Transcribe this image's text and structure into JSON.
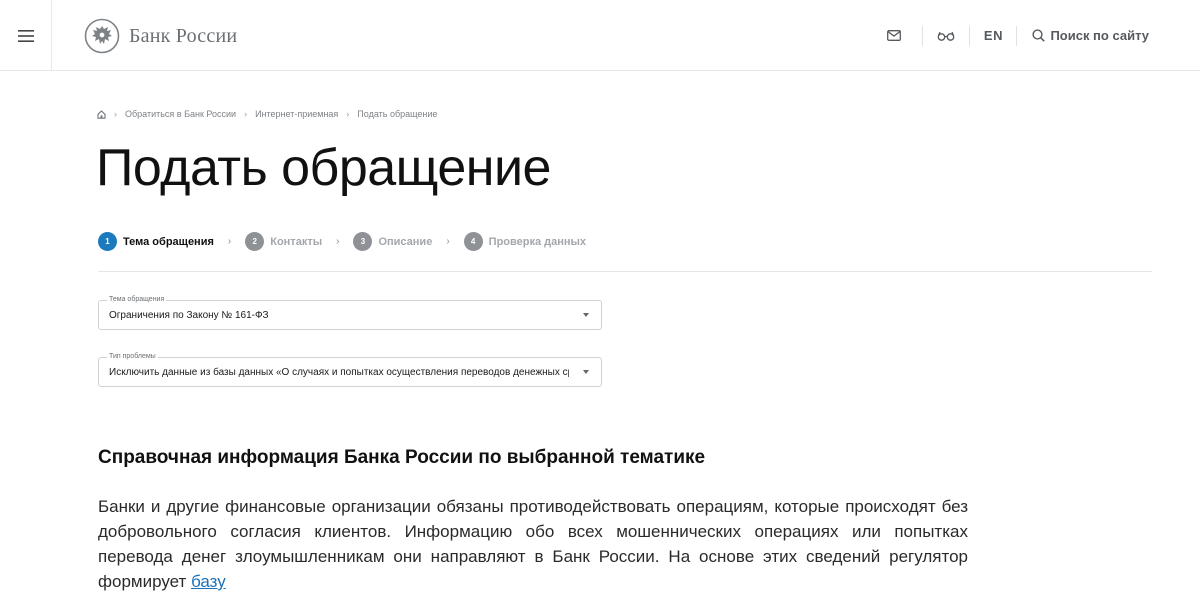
{
  "header": {
    "logo_text": "Банк России",
    "lang": "EN",
    "search_label": "Поиск по сайту"
  },
  "breadcrumb": [
    {
      "label": "Обратиться в Банк России"
    },
    {
      "label": "Интернет-приемная"
    },
    {
      "label": "Подать обращение"
    }
  ],
  "page_title": "Подать обращение",
  "steps": [
    {
      "num": "1",
      "label": "Тема обращения",
      "active": true
    },
    {
      "num": "2",
      "label": "Контакты",
      "active": false
    },
    {
      "num": "3",
      "label": "Описание",
      "active": false
    },
    {
      "num": "4",
      "label": "Проверка данных",
      "active": false
    }
  ],
  "form": {
    "topic": {
      "label": "Тема обращения",
      "value": "Ограничения по Закону № 161-ФЗ"
    },
    "problem_type": {
      "label": "Тип проблемы",
      "value": "Исключить данные из базы данных «О случаях и попытках осуществления переводов денежных средств без согласия клиента»"
    }
  },
  "info": {
    "title": "Справочная информация Банка России по выбранной тематике",
    "text": "Банки и другие финансовые организации обязаны противодействовать операциям, которые происходят без добровольного согласия клиентов. Информацию обо всех мошеннических операциях или попытках перевода денег злоумышленникам они направляют в Банк России. На основе этих сведений регулятор формирует ",
    "link": "базу"
  },
  "colors": {
    "accent": "#1b79be",
    "link": "#1b6fb8",
    "inactive_step": "#8e9297"
  }
}
